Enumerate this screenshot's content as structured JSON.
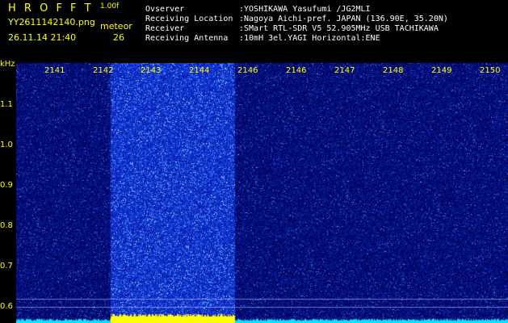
{
  "header": {
    "app_name": "H R O F F T",
    "version": "1.00f",
    "filename": "YY2611142140.png",
    "datetime": "26.11.14 21:40",
    "meteor_label": "meteor",
    "meteor_count": "26",
    "info": [
      {
        "label": "Ovserver",
        "value": ":YOSHIKAWA Yasufumi /JG2MLI"
      },
      {
        "label": "Receiving Location",
        "value": ":Nagoya Aichi-pref. JAPAN (136.90E, 35.20N)"
      },
      {
        "label": "Receiver",
        "value": ":SMart RTL-SDR V5 52.905MHz USB TACHIKAWA"
      },
      {
        "label": "Receiving Antenna",
        "value": ":10mH 3el.YAGI Horizontal:ENE"
      }
    ]
  },
  "spectrogram": {
    "y_unit": "kHz",
    "y_ticks": [
      "1.1",
      "1.0",
      "0.9",
      "0.8",
      "0.7",
      "0.6"
    ],
    "x_ticks": [
      "2141",
      "2142",
      "2143",
      "2144",
      "2146",
      "2146",
      "2147",
      "2148",
      "2149",
      "2150"
    ],
    "active_minutes": "2143-2144",
    "colors": {
      "background": "#000066",
      "low": "#0a1a9a",
      "mid": "#2a6aff",
      "high": "#7fe8ff",
      "baseline": "#00e5ff",
      "event": "#ffff00",
      "label": "#ffff00"
    }
  }
}
